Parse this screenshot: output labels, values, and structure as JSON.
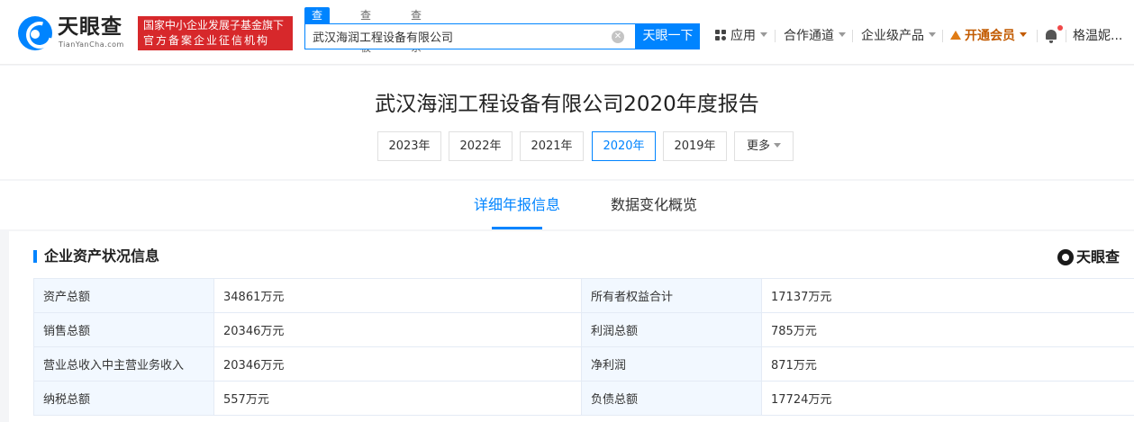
{
  "header": {
    "logo_name": "天眼查",
    "logo_domain": "TianYanCha.com",
    "badge_line1": "国家中小企业发展子基金旗下",
    "badge_line2": "官方备案企业征信机构",
    "search_tabs": [
      "查公司",
      "查老板",
      "查关系"
    ],
    "search_value": "武汉海润工程设备有限公司",
    "search_button": "天眼一下",
    "nav": {
      "apps": "应用",
      "channel": "合作通道",
      "enterprise": "企业级产品",
      "vip": "开通会员",
      "user": "格温妮..."
    },
    "colors": {
      "brand": "#0084ff",
      "badge": "#d7282b",
      "vip": "#c25a00"
    }
  },
  "report": {
    "title": "武汉海润工程设备有限公司2020年度报告",
    "years": [
      "2023年",
      "2022年",
      "2021年",
      "2020年",
      "2019年"
    ],
    "selected_year": "2020年",
    "more": "更多"
  },
  "sub_tabs": {
    "detail": "详细年报信息",
    "changes": "数据变化概览",
    "active": "详细年报信息"
  },
  "section": {
    "title": "企业资产状况信息",
    "watermark": "天眼查",
    "rows": [
      {
        "k1": "资产总额",
        "v1": "34861万元",
        "k2": "所有者权益合计",
        "v2": "17137万元"
      },
      {
        "k1": "销售总额",
        "v1": "20346万元",
        "k2": "利润总额",
        "v2": "785万元"
      },
      {
        "k1": "营业总收入中主营业务收入",
        "v1": "20346万元",
        "k2": "净利润",
        "v2": "871万元"
      },
      {
        "k1": "纳税总额",
        "v1": "557万元",
        "k2": "负债总额",
        "v2": "17724万元"
      }
    ]
  }
}
